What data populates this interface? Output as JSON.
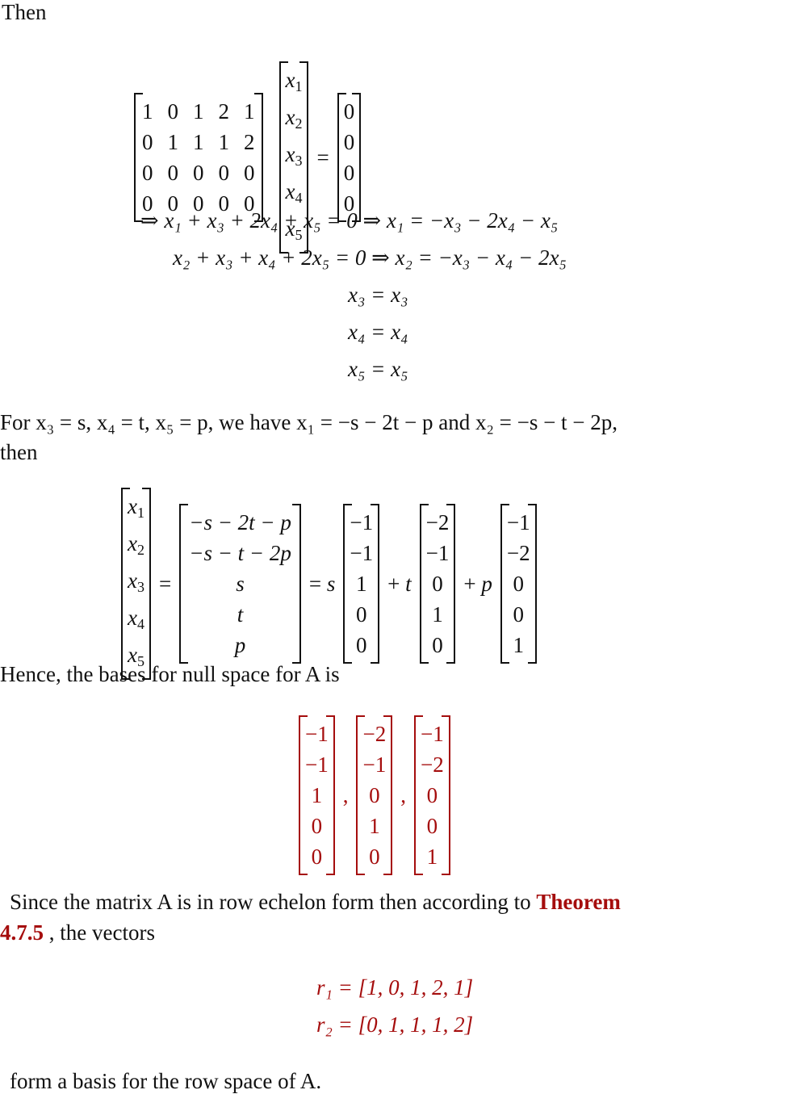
{
  "intro": "Then",
  "matrix_A": [
    [
      "1",
      "0",
      "1",
      "2",
      "1"
    ],
    [
      "0",
      "1",
      "1",
      "1",
      "2"
    ],
    [
      "0",
      "0",
      "0",
      "0",
      "0"
    ],
    [
      "0",
      "0",
      "0",
      "0",
      "0"
    ]
  ],
  "vec_x": [
    "x1",
    "x2",
    "x3",
    "x4",
    "x5"
  ],
  "vec_zero": [
    "0",
    "0",
    "0",
    "0"
  ],
  "equations": [
    "⇒ x₁ + x₃ + 2x₄ + x₅ = 0 ⇒ x₁ = −x₃ − 2x₄ − x₅",
    "x₂ + x₃ + x₄ + 2x₅ = 0 ⇒ x₂ = −x₃ − x₄ − 2x₅",
    "x₃ = x₃",
    "x₄ = x₄",
    "x₅ = x₅"
  ],
  "param_line1": "For x₃ = s, x₄ = t, x₅ = p, we have x₁ = −s − 2t − p and x₂ = −s − t − 2p,",
  "param_line2": "then",
  "general": [
    "−s − 2t − p",
    "−s − t − 2p",
    "s",
    "t",
    "p"
  ],
  "coef": [
    "s",
    "t",
    "p"
  ],
  "basis": [
    [
      "−1",
      "−1",
      "1",
      "0",
      "0"
    ],
    [
      "−2",
      "−1",
      "0",
      "1",
      "0"
    ],
    [
      "−1",
      "−2",
      "0",
      "0",
      "1"
    ]
  ],
  "hence": "Hence, the bases for null space for A is",
  "since_line1_a": "Since the matrix A is in row echelon form then according to ",
  "theorem": "Theorem",
  "theorem_num": "4.7.5",
  "since_line2_b": " , the vectors",
  "rows": [
    "r₁ = [1, 0, 1, 2, 1]",
    "r₂ = [0, 1, 1, 1, 2]"
  ],
  "conclusion": "form a basis for the row space of A."
}
